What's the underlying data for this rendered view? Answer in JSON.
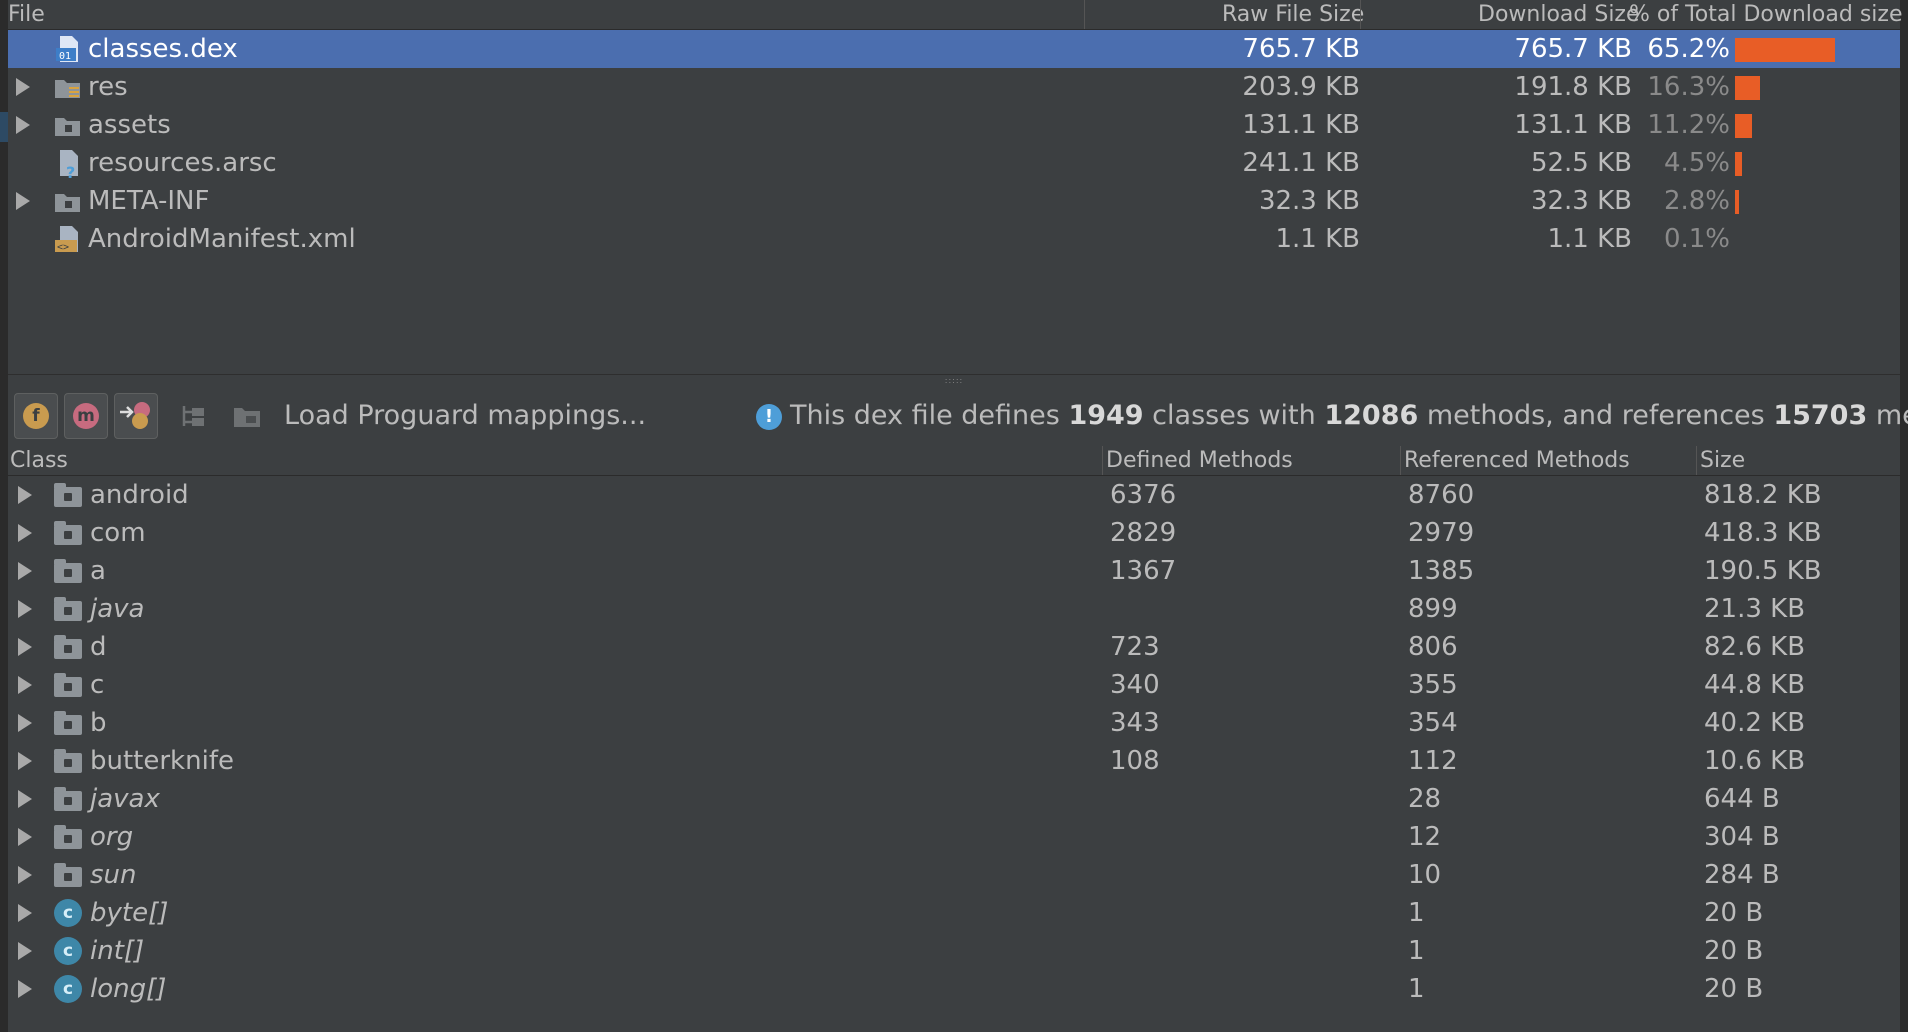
{
  "file_table": {
    "columns": [
      "File",
      "Raw File Size",
      "Download Size",
      "% of Total Download size"
    ],
    "rows": [
      {
        "name": "classes.dex",
        "raw": "765.7 KB",
        "download": "765.7 KB",
        "percent": "65.2%",
        "share": 0.652,
        "expandable": false,
        "selected": true,
        "icon": "dex-file-icon"
      },
      {
        "name": "res",
        "raw": "203.9 KB",
        "download": "191.8 KB",
        "percent": "16.3%",
        "share": 0.163,
        "expandable": true,
        "selected": false,
        "icon": "res-folder-icon"
      },
      {
        "name": "assets",
        "raw": "131.1 KB",
        "download": "131.1 KB",
        "percent": "11.2%",
        "share": 0.112,
        "expandable": true,
        "selected": false,
        "icon": "folder-icon"
      },
      {
        "name": "resources.arsc",
        "raw": "241.1 KB",
        "download": "52.5 KB",
        "percent": "4.5%",
        "share": 0.045,
        "expandable": false,
        "selected": false,
        "icon": "unknown-file-icon"
      },
      {
        "name": "META-INF",
        "raw": "32.3 KB",
        "download": "32.3 KB",
        "percent": "2.8%",
        "share": 0.028,
        "expandable": true,
        "selected": false,
        "icon": "folder-icon"
      },
      {
        "name": "AndroidManifest.xml",
        "raw": "1.1 KB",
        "download": "1.1 KB",
        "percent": "0.1%",
        "share": 0.001,
        "expandable": false,
        "selected": false,
        "icon": "xml-file-icon"
      }
    ],
    "bar_color": "#e85d26",
    "selection_color": "#4b6eaf"
  },
  "toolbar": {
    "buttons": [
      {
        "name": "show-fields-button",
        "glyph": "f",
        "color": "#c99b4f"
      },
      {
        "name": "show-methods-button",
        "glyph": "m",
        "color": "#c76b7f"
      },
      {
        "name": "show-referenced-button",
        "glyph": "m",
        "color": "#c76b7f"
      }
    ],
    "load_label": "Load Proguard mappings...",
    "info": {
      "text_1": "This dex file defines ",
      "classes": "1949",
      "text_2": " classes with ",
      "methods": "12086",
      "text_3": " methods, and references ",
      "referenced": "15703",
      "text_4": " methods."
    }
  },
  "class_table": {
    "columns": [
      "Class",
      "Defined Methods",
      "Referenced Methods",
      "Size"
    ],
    "rows": [
      {
        "name": "android",
        "defined": "6376",
        "referenced": "8760",
        "size": "818.2 KB",
        "kind": "package",
        "italic": false
      },
      {
        "name": "com",
        "defined": "2829",
        "referenced": "2979",
        "size": "418.3 KB",
        "kind": "package",
        "italic": false
      },
      {
        "name": "a",
        "defined": "1367",
        "referenced": "1385",
        "size": "190.5 KB",
        "kind": "package",
        "italic": false
      },
      {
        "name": "java",
        "defined": "",
        "referenced": "899",
        "size": "21.3 KB",
        "kind": "package",
        "italic": true
      },
      {
        "name": "d",
        "defined": "723",
        "referenced": "806",
        "size": "82.6 KB",
        "kind": "package",
        "italic": false
      },
      {
        "name": "c",
        "defined": "340",
        "referenced": "355",
        "size": "44.8 KB",
        "kind": "package",
        "italic": false
      },
      {
        "name": "b",
        "defined": "343",
        "referenced": "354",
        "size": "40.2 KB",
        "kind": "package",
        "italic": false
      },
      {
        "name": "butterknife",
        "defined": "108",
        "referenced": "112",
        "size": "10.6 KB",
        "kind": "package",
        "italic": false
      },
      {
        "name": "javax",
        "defined": "",
        "referenced": "28",
        "size": "644 B",
        "kind": "package",
        "italic": true
      },
      {
        "name": "org",
        "defined": "",
        "referenced": "12",
        "size": "304 B",
        "kind": "package",
        "italic": true
      },
      {
        "name": "sun",
        "defined": "",
        "referenced": "10",
        "size": "284 B",
        "kind": "package",
        "italic": true
      },
      {
        "name": "byte[]",
        "defined": "",
        "referenced": "1",
        "size": "20 B",
        "kind": "class",
        "italic": true
      },
      {
        "name": "int[]",
        "defined": "",
        "referenced": "1",
        "size": "20 B",
        "kind": "class",
        "italic": true
      },
      {
        "name": "long[]",
        "defined": "",
        "referenced": "1",
        "size": "20 B",
        "kind": "class",
        "italic": true
      }
    ]
  }
}
